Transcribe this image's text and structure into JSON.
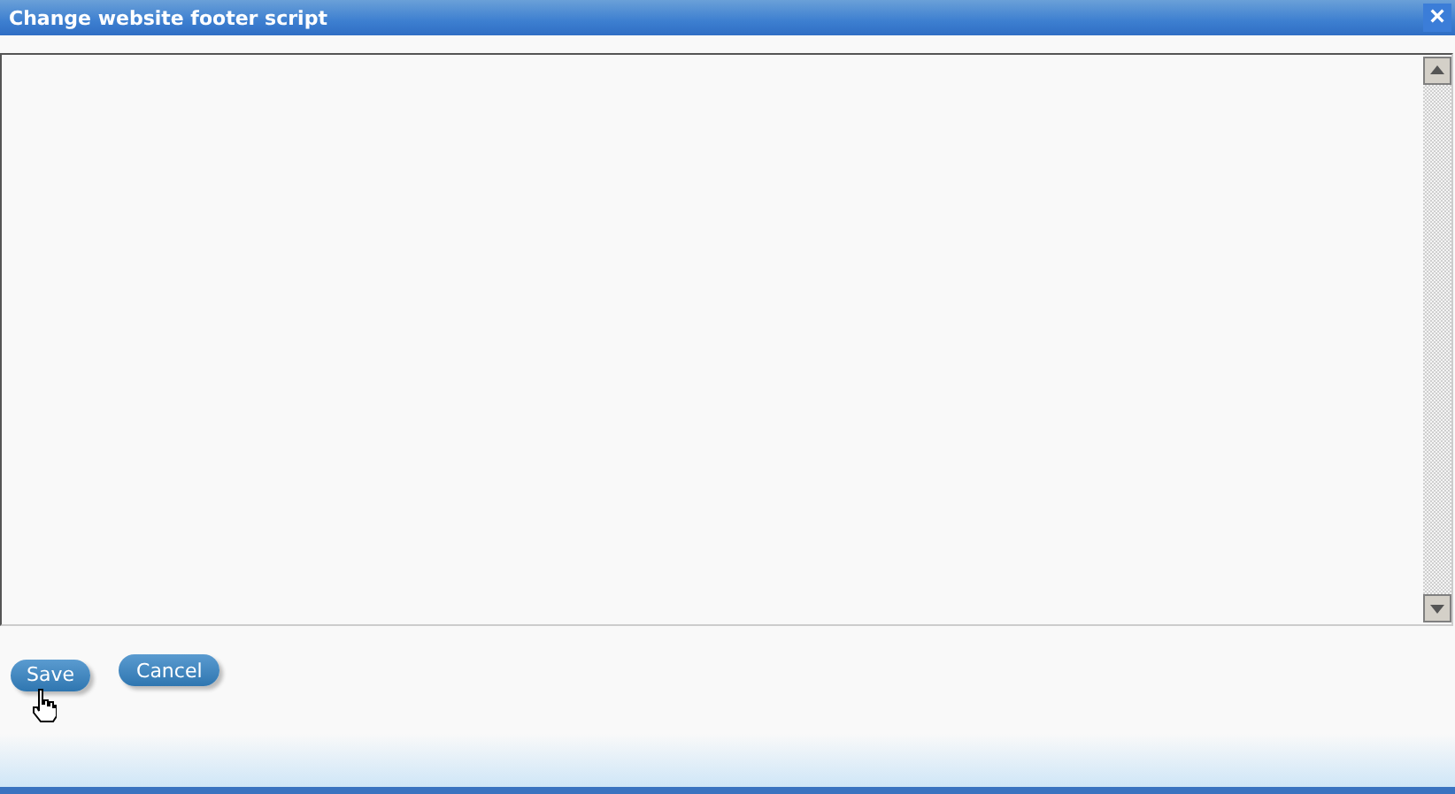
{
  "window": {
    "title": "Change website footer script",
    "close": "×"
  },
  "buttons": [
    {
      "label": "Save",
      "kind": "primary"
    },
    {
      "label": "Cancel",
      "kind": "secondary"
    }
  ],
  "cursor": {
    "kind": "hand"
  }
}
